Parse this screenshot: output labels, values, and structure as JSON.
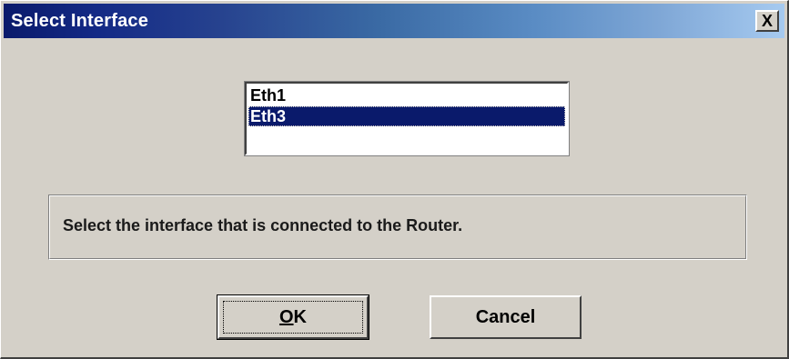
{
  "window": {
    "title": "Select Interface",
    "close_label": "X"
  },
  "interfaces": {
    "items": [
      {
        "label": "Eth1",
        "selected": false
      },
      {
        "label": "Eth3",
        "selected": true
      }
    ]
  },
  "message": {
    "text": "Select the interface that is connected to the Router."
  },
  "buttons": {
    "ok_label": "OK",
    "ok_mnemonic": "O",
    "cancel_label": "Cancel"
  },
  "colors": {
    "title_bar_start": "#0a1a6b",
    "title_bar_end": "#a6caf0",
    "dialog_face": "#d4d0c8",
    "selection": "#0a1a6b"
  }
}
